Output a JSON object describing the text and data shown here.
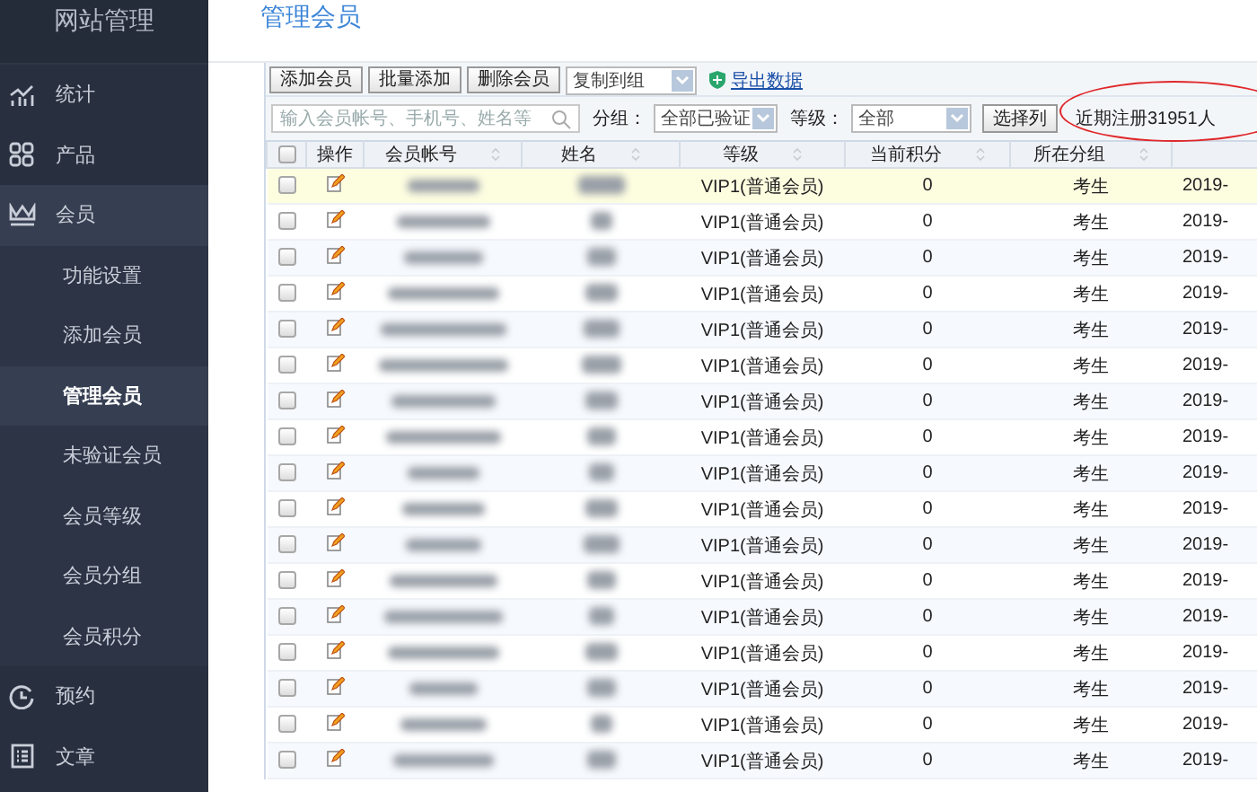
{
  "sidebar": {
    "title": "网站管理",
    "items": [
      {
        "label": "统计",
        "expanded": false,
        "selected": false
      },
      {
        "label": "产品",
        "expanded": false,
        "selected": false
      },
      {
        "label": "会员",
        "expanded": true,
        "selected": false,
        "children": [
          {
            "label": "功能设置",
            "selected": false
          },
          {
            "label": "添加会员",
            "selected": false
          },
          {
            "label": "管理会员",
            "selected": true
          },
          {
            "label": "未验证会员",
            "selected": false
          },
          {
            "label": "会员等级",
            "selected": false
          },
          {
            "label": "会员分组",
            "selected": false
          },
          {
            "label": "会员积分",
            "selected": false
          }
        ]
      },
      {
        "label": "预约",
        "expanded": false,
        "selected": false
      },
      {
        "label": "文章",
        "expanded": false,
        "selected": false
      }
    ]
  },
  "page_title": "管理会员",
  "toolbar": {
    "buttons": [
      "添加会员",
      "批量添加",
      "删除会员"
    ],
    "copy_select": "复制到组",
    "export_link": "导出数据"
  },
  "filters": {
    "search_placeholder": "输入会员帐号、手机号、姓名等",
    "group_label": "分组：",
    "group_value": "全部已验证",
    "grade_label": "等级：",
    "grade_value": "全部",
    "choose_button": "选择列",
    "recent_text": "近期注册31951人"
  },
  "table": {
    "header_checked": false,
    "columns": [
      "操作",
      "会员帐号",
      "姓名",
      "等级",
      "当前积分",
      "所在分组"
    ],
    "rows": [
      {
        "selected": true,
        "checked": false,
        "grade": "VIP1(普通会员)",
        "points": "0",
        "group": "考生",
        "date": "2019-"
      },
      {
        "selected": false,
        "checked": false,
        "grade": "VIP1(普通会员)",
        "points": "0",
        "group": "考生",
        "date": "2019-"
      },
      {
        "selected": false,
        "checked": false,
        "grade": "VIP1(普通会员)",
        "points": "0",
        "group": "考生",
        "date": "2019-"
      },
      {
        "selected": false,
        "checked": false,
        "grade": "VIP1(普通会员)",
        "points": "0",
        "group": "考生",
        "date": "2019-"
      },
      {
        "selected": false,
        "checked": false,
        "grade": "VIP1(普通会员)",
        "points": "0",
        "group": "考生",
        "date": "2019-"
      },
      {
        "selected": false,
        "checked": false,
        "grade": "VIP1(普通会员)",
        "points": "0",
        "group": "考生",
        "date": "2019-"
      },
      {
        "selected": false,
        "checked": false,
        "grade": "VIP1(普通会员)",
        "points": "0",
        "group": "考生",
        "date": "2019-"
      },
      {
        "selected": false,
        "checked": false,
        "grade": "VIP1(普通会员)",
        "points": "0",
        "group": "考生",
        "date": "2019-"
      },
      {
        "selected": false,
        "checked": false,
        "grade": "VIP1(普通会员)",
        "points": "0",
        "group": "考生",
        "date": "2019-"
      },
      {
        "selected": false,
        "checked": false,
        "grade": "VIP1(普通会员)",
        "points": "0",
        "group": "考生",
        "date": "2019-"
      },
      {
        "selected": false,
        "checked": false,
        "grade": "VIP1(普通会员)",
        "points": "0",
        "group": "考生",
        "date": "2019-"
      },
      {
        "selected": false,
        "checked": false,
        "grade": "VIP1(普通会员)",
        "points": "0",
        "group": "考生",
        "date": "2019-"
      },
      {
        "selected": false,
        "checked": false,
        "grade": "VIP1(普通会员)",
        "points": "0",
        "group": "考生",
        "date": "2019-"
      },
      {
        "selected": false,
        "checked": false,
        "grade": "VIP1(普通会员)",
        "points": "0",
        "group": "考生",
        "date": "2019-"
      },
      {
        "selected": false,
        "checked": false,
        "grade": "VIP1(普通会员)",
        "points": "0",
        "group": "考生",
        "date": "2019-"
      },
      {
        "selected": false,
        "checked": false,
        "grade": "VIP1(普通会员)",
        "points": "0",
        "group": "考生",
        "date": "2019-"
      },
      {
        "selected": false,
        "checked": false,
        "grade": "VIP1(普通会员)",
        "points": "0",
        "group": "考生",
        "date": "2019-"
      }
    ]
  }
}
